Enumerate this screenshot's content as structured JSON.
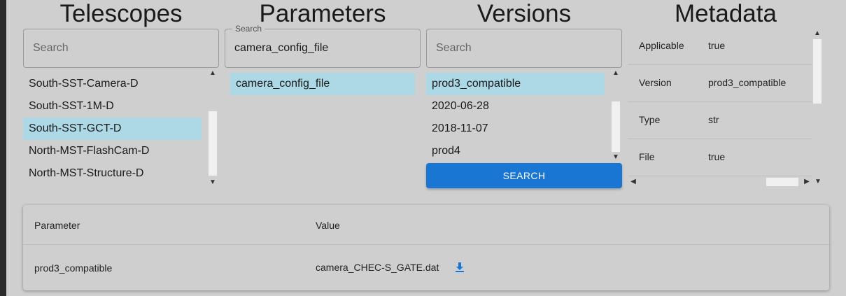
{
  "columns": {
    "telescopes": {
      "title": "Telescopes",
      "search_placeholder": "Search",
      "items": [
        "South-SST-Camera-D",
        "South-SST-1M-D",
        "South-SST-GCT-D",
        "North-MST-FlashCam-D",
        "North-MST-Structure-D"
      ],
      "selected_index": 2
    },
    "parameters": {
      "title": "Parameters",
      "search_label": "Search",
      "search_value": "camera_config_file",
      "items": [
        "camera_config_file"
      ],
      "selected_index": 0
    },
    "versions": {
      "title": "Versions",
      "search_placeholder": "Search",
      "items": [
        "prod3_compatible",
        "2020-06-28",
        "2018-11-07",
        "prod4"
      ],
      "selected_index": 0,
      "search_button": "SEARCH"
    },
    "metadata": {
      "title": "Metadata",
      "rows": [
        {
          "key": "Applicable",
          "value": "true"
        },
        {
          "key": "Version",
          "value": "prod3_compatible"
        },
        {
          "key": "Type",
          "value": "str"
        },
        {
          "key": "File",
          "value": "true"
        }
      ]
    }
  },
  "results": {
    "headers": {
      "parameter": "Parameter",
      "value": "Value"
    },
    "rows": [
      {
        "parameter": "prod3_compatible",
        "value": "camera_CHEC-S_GATE.dat"
      }
    ]
  },
  "icons": {
    "download": "download-icon",
    "scroll_up": "chevron-up-icon",
    "scroll_down": "chevron-down-icon",
    "scroll_left": "chevron-left-icon",
    "scroll_right": "chevron-right-icon"
  },
  "colors": {
    "background": "#cfcfcf",
    "selected": "#add8e6",
    "primary": "#1976d2"
  }
}
